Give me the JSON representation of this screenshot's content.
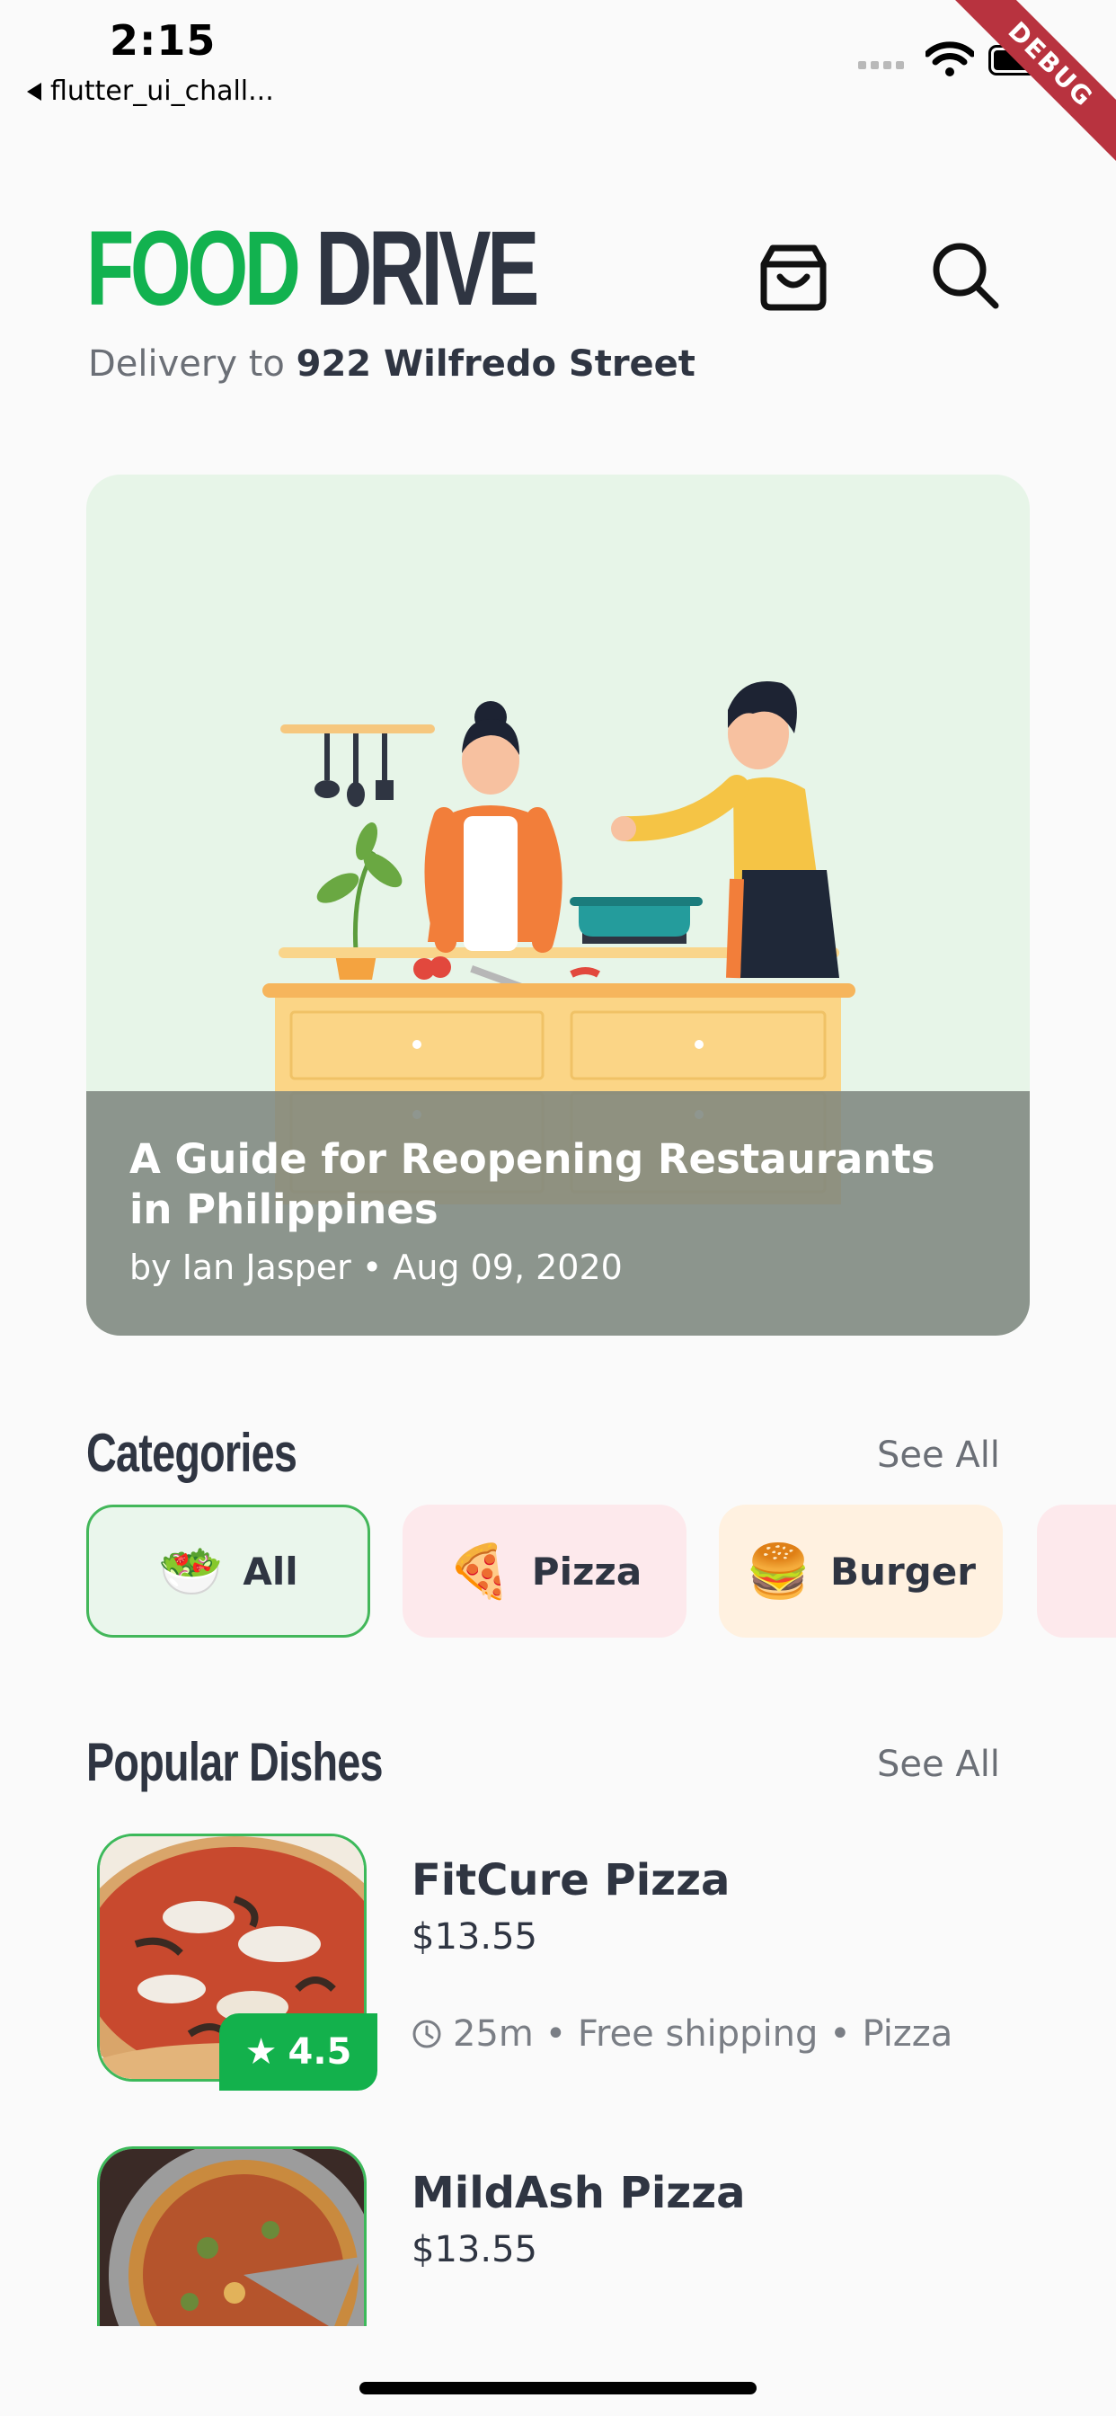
{
  "status_bar": {
    "time": "2:15",
    "back_app": "flutter_ui_chall...",
    "debug_label": "DEBUG"
  },
  "header": {
    "brand_word1": "FOOD",
    "brand_word2": "DRIVE",
    "delivery_prefix": "Delivery to",
    "delivery_address": "922 Wilfredo Street",
    "icons": [
      "shopping-bag-icon",
      "search-icon"
    ]
  },
  "hero": {
    "title": "A Guide for Reopening Restaurants in Philippines",
    "meta": "by Ian Jasper • Aug 09, 2020"
  },
  "categories": {
    "title": "Categories",
    "see_all": "See All",
    "items": [
      {
        "label": "All",
        "emoji": "🥗",
        "selected": true,
        "bg": "#eaf6ec"
      },
      {
        "label": "Pizza",
        "emoji": "🍕",
        "selected": false,
        "bg": "#fde9ec"
      },
      {
        "label": "Burger",
        "emoji": "🍔",
        "selected": false,
        "bg": "#fff1e0"
      }
    ]
  },
  "popular": {
    "title": "Popular Dishes",
    "see_all": "See All",
    "dishes": [
      {
        "name": "FitCure Pizza",
        "price": "$13.55",
        "time": "25m",
        "meta": "25m • Free shipping • Pizza",
        "rating": "4.5"
      },
      {
        "name": "MildAsh Pizza",
        "price": "$13.55"
      }
    ]
  },
  "colors": {
    "brand_green": "#12b24f",
    "dark": "#2f3542"
  }
}
